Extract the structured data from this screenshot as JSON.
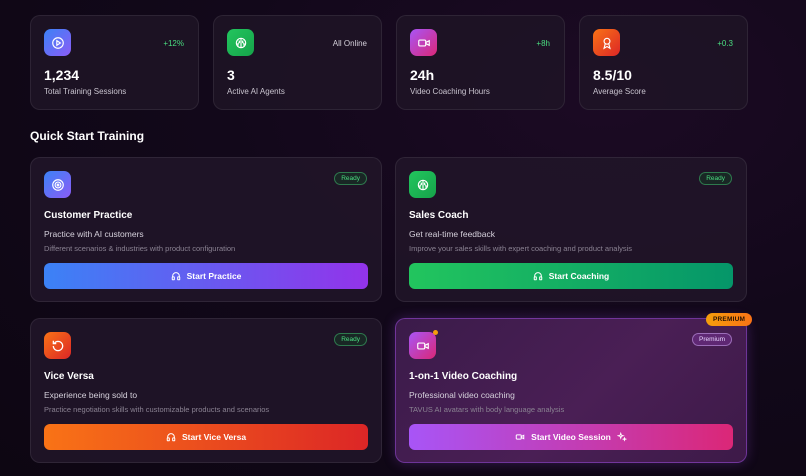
{
  "stats": [
    {
      "value": "1,234",
      "label": "Total Training Sessions",
      "delta": "+12%",
      "icon": "play-circle-icon",
      "color": "#6366f1"
    },
    {
      "value": "3",
      "label": "Active AI Agents",
      "delta": "All Online",
      "icon": "brain-icon",
      "color": "#22c55e"
    },
    {
      "value": "24h",
      "label": "Video Coaching Hours",
      "delta": "+8h",
      "icon": "video-icon",
      "color": "#c026d3"
    },
    {
      "value": "8.5/10",
      "label": "Average Score",
      "delta": "+0.3",
      "icon": "award-icon",
      "color": "#f97316"
    }
  ],
  "section_title": "Quick Start Training",
  "cards": [
    {
      "title": "Customer Practice",
      "subtitle": "Practice with AI customers",
      "description": "Different scenarios & industries with product configuration",
      "badge": "Ready",
      "button": "Start Practice",
      "icon": "target-icon"
    },
    {
      "title": "Sales Coach",
      "subtitle": "Get real-time feedback",
      "description": "Improve your sales skills with expert coaching and product analysis",
      "badge": "Ready",
      "button": "Start Coaching",
      "icon": "brain-icon"
    },
    {
      "title": "Vice Versa",
      "subtitle": "Experience being sold to",
      "description": "Practice negotiation skills with customizable products and scenarios",
      "badge": "Ready",
      "button": "Start Vice Versa",
      "icon": "rotate-icon"
    },
    {
      "title": "1-on-1 Video Coaching",
      "subtitle": "Professional video coaching",
      "description": "TAVUS AI avatars with body language analysis",
      "badge": "Premium",
      "button": "Start Video Session",
      "icon": "video-icon",
      "tag": "PREMIUM"
    }
  ]
}
